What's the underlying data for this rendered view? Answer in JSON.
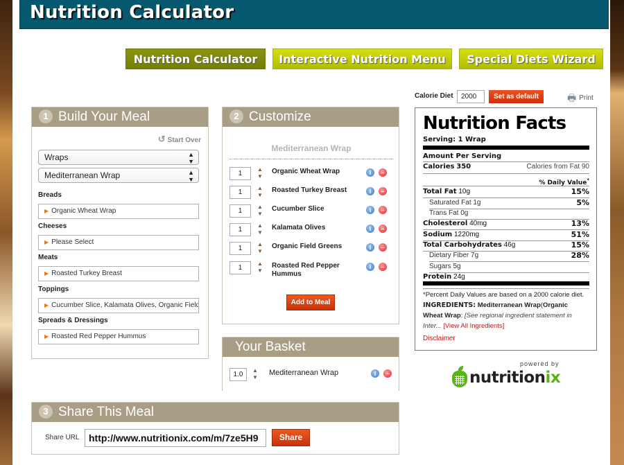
{
  "header": {
    "title": "Nutrition Calculator"
  },
  "nav": {
    "tabs": [
      {
        "label": "Nutrition Calculator",
        "active": true
      },
      {
        "label": "Interactive Nutrition Menu",
        "active": false
      },
      {
        "label": "Special Diets Wizard",
        "active": false
      }
    ]
  },
  "build": {
    "step": "1",
    "title": "Build Your Meal",
    "start_over": "Start Over",
    "category_select": "Wraps",
    "item_select": "Mediterranean Wrap",
    "groups": [
      {
        "label": "Breads",
        "value": "Organic Wheat Wrap"
      },
      {
        "label": "Cheeses",
        "value": "Please Select"
      },
      {
        "label": "Meats",
        "value": "Roasted Turkey Breast"
      },
      {
        "label": "Toppings",
        "value": "Cucumber Slice, Kalamata Olives, Organic Field Greens"
      },
      {
        "label": "Spreads & Dressings",
        "value": "Roasted Red Pepper Hummus"
      }
    ]
  },
  "customize": {
    "step": "2",
    "title": "Customize",
    "item_title": "Mediterranean Wrap",
    "ingredients": [
      {
        "qty": "1",
        "name": "Organic Wheat Wrap"
      },
      {
        "qty": "1",
        "name": "Roasted Turkey Breast"
      },
      {
        "qty": "1",
        "name": "Cucumber Slice"
      },
      {
        "qty": "1",
        "name": "Kalamata Olives"
      },
      {
        "qty": "1",
        "name": "Organic Field Greens"
      },
      {
        "qty": "1",
        "name": "Roasted Red Pepper Hummus"
      }
    ],
    "add_button": "Add to Meal"
  },
  "basket": {
    "title": "Your Basket",
    "items": [
      {
        "qty": "1.0",
        "name": "Mediterranean Wrap"
      }
    ]
  },
  "share": {
    "step": "3",
    "title": "Share This Meal",
    "label": "Share URL",
    "url": "http://www.nutritionix.com/m/7ze5H9",
    "button": "Share"
  },
  "calorie_diet": {
    "label": "Calorie Diet",
    "value": "2000",
    "default_button": "Set as default",
    "print": "Print"
  },
  "nutrition_facts": {
    "title": "Nutrition Facts",
    "serving": "Serving: 1 Wrap",
    "amount_per_serving": "Amount Per Serving",
    "calories_label": "Calories",
    "calories": "350",
    "calories_from_fat": "Calories from Fat 90",
    "daily_value_header": "% Daily Value",
    "daily_value_mark": "*",
    "rows": [
      {
        "label": "Total Fat",
        "amount": "10g",
        "dv": "15%",
        "bold": true,
        "indent": false
      },
      {
        "label": "Saturated Fat",
        "amount": "1g",
        "dv": "5%",
        "bold": false,
        "indent": true
      },
      {
        "label": "Trans Fat",
        "amount": "0g",
        "dv": "",
        "bold": false,
        "indent": true
      },
      {
        "label": "Cholesterol",
        "amount": "40mg",
        "dv": "13%",
        "bold": true,
        "indent": false
      },
      {
        "label": "Sodium",
        "amount": "1220mg",
        "dv": "51%",
        "bold": true,
        "indent": false
      },
      {
        "label": "Total Carbohydrates",
        "amount": "46g",
        "dv": "15%",
        "bold": true,
        "indent": false
      },
      {
        "label": "Dietary Fiber",
        "amount": "7g",
        "dv": "28%",
        "bold": false,
        "indent": true
      },
      {
        "label": "Sugars",
        "amount": "5g",
        "dv": "",
        "bold": false,
        "indent": true
      },
      {
        "label": "Protein",
        "amount": "24g",
        "dv": "",
        "bold": true,
        "indent": false
      }
    ],
    "footnote": "*Percent Daily Values are based on a 2000 calorie diet.",
    "ingredients_label": "INGREDIENTS:",
    "ingredients_item": "Mediterranean Wrap",
    "ingredients_paren": "(",
    "ingredients_first": "Organic Wheat Wrap",
    "ingredients_colon": ":",
    "ingredients_note": "[See regional ingredient statement in Inter...",
    "view_all": "[View All Ingredients]",
    "disclaimer": "Disclaimer"
  },
  "branding": {
    "powered_by": "powered by",
    "logo_a": "nutrition",
    "logo_b": "ix"
  },
  "colors": {
    "header_bg": "#06586f",
    "panel_head": "#a89e86",
    "nav_active": "#7e8a08",
    "nav_light": "#c4d00a",
    "action_red": "#d8400f",
    "brand_green": "#58b410"
  }
}
